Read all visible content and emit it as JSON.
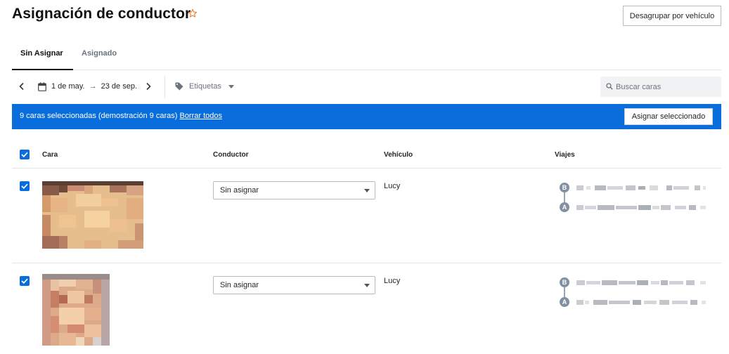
{
  "header": {
    "title": "Asignación de conductor",
    "ungroup_label": "Desagrupar por vehículo"
  },
  "tabs": [
    {
      "label": "Sin Asignar",
      "active": true
    },
    {
      "label": "Asignado",
      "active": false
    }
  ],
  "filters": {
    "date_start": "1 de may.",
    "date_separator": "→",
    "date_end": "23 de sep.",
    "tags_label": "Etiquetas",
    "search_placeholder": "Buscar caras"
  },
  "banner": {
    "text": "9 caras seleccionadas (demostración 9 caras)",
    "clear_link": "Borrar todos",
    "assign_label": "Asignar seleccionado"
  },
  "table": {
    "columns": [
      "Cara",
      "Conductor",
      "Vehículo",
      "Viajes"
    ],
    "rows": [
      {
        "checked": true,
        "driver": "Sin asignar",
        "vehicle": "Lucy",
        "trip_start": "B",
        "trip_end": "A"
      },
      {
        "checked": true,
        "driver": "Sin asignar",
        "vehicle": "Lucy",
        "trip_start": "B",
        "trip_end": "A"
      }
    ]
  },
  "colors": {
    "accent": "#0a6ddc",
    "star": "#e8823a",
    "trip_marker": "#8390a3"
  }
}
